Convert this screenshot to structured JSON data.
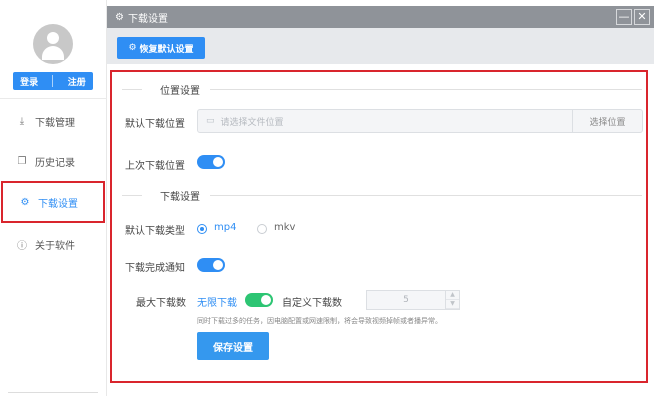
{
  "sidebar": {
    "login_label": "登录",
    "register_label": "注册",
    "items": [
      {
        "icon": "download-icon",
        "glyph": "⤓",
        "label": "下载管理"
      },
      {
        "icon": "history-icon",
        "glyph": "❐",
        "label": "历史记录"
      },
      {
        "icon": "gear-icon",
        "glyph": "⚙",
        "label": "下载设置"
      },
      {
        "icon": "info-icon",
        "glyph": "ⓘ",
        "label": "关于软件"
      }
    ],
    "active_index": 2
  },
  "window": {
    "title": "下载设置",
    "title_glyph": "⚙",
    "minimize_glyph": "—",
    "close_glyph": "✕"
  },
  "toolbar": {
    "reset_glyph": "⚙",
    "reset_label": "恢复默认设置"
  },
  "location_section": {
    "title": "位置设置",
    "default_label": "默认下载位置",
    "path_placeholder": "请选择文件位置",
    "choose_label": "选择位置",
    "last_label": "上次下载位置",
    "last_enabled": true
  },
  "download_section": {
    "title": "下载设置",
    "type_label": "默认下载类型",
    "types": [
      "mp4",
      "mkv"
    ],
    "selected_type": "mp4",
    "notify_label": "下载完成通知",
    "notify_enabled": true,
    "max_label": "最大下载数",
    "unlimited_label": "无限下载",
    "unlimited_enabled": true,
    "custom_label": "自定义下载数",
    "custom_value": "5",
    "hint": "同时下载过多的任务，因电脑配置或网速限制，将会导致视频掉帧或者播异常。",
    "save_label": "保存设置"
  },
  "colors": {
    "accent": "#2f8ef4",
    "highlight_border": "#d9252d",
    "toggle_green": "#2dc573",
    "titlebar": "#8f9399"
  }
}
